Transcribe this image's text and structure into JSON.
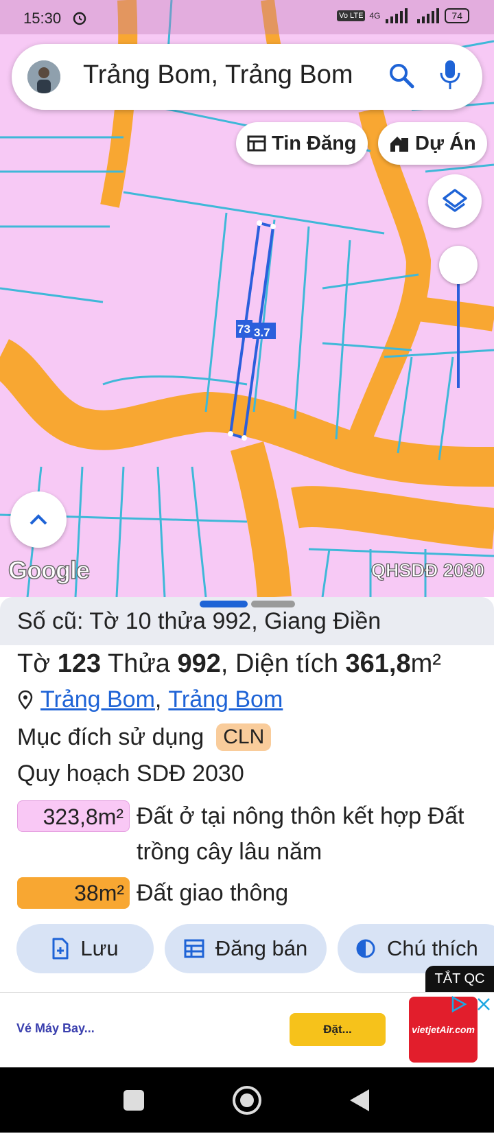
{
  "status_bar": {
    "time": "15:30",
    "network": "4G",
    "volte": "Vo LTE",
    "battery": "74"
  },
  "search": {
    "query": "Trảng Bom, Trảng Bom"
  },
  "chips": {
    "listing": "Tin Đăng",
    "project": "Dự Án"
  },
  "map": {
    "parcel_label_1": "73",
    "parcel_label_2": "3.7",
    "attribution": "Google",
    "layer_name": "QHSDĐ 2030"
  },
  "sheet": {
    "old_parcel": "Số cũ: Tờ 10 thửa 992, Giang Điền",
    "sheet_prefix": "Tờ",
    "sheet_no": "123",
    "parcel_prefix": "Thửa",
    "parcel_no": "992",
    "area_prefix": "Diện tích",
    "area_value": "361,8",
    "area_unit": "m²",
    "location_part1": "Trảng Bom",
    "location_sep": ",",
    "location_part2": "Trảng Bom",
    "use_label": "Mục đích sử dụng",
    "use_code": "CLN",
    "plan_label": "Quy hoạch SDĐ 2030",
    "plan_items": [
      {
        "area": "323,8m²",
        "desc": "Đất ở tại nông thôn kết hợp Đất trồng cây lâu năm",
        "color": "#f9c8f5"
      },
      {
        "area": "38m²",
        "desc": "Đất giao thông",
        "color": "#f8a732"
      }
    ],
    "actions": {
      "save": "Lưu",
      "post": "Đăng bán",
      "legend": "Chú thích"
    }
  },
  "ad": {
    "close_label": "TẮT QC",
    "text": "Vé Máy Bay...",
    "cta": "Đặt...",
    "brand": "vietjetAir.com"
  },
  "colors": {
    "accent": "#1e63d6",
    "road": "#f8a732",
    "parcel_fill": "#f9c8f5",
    "parcel_line": "#3fb8d8"
  }
}
